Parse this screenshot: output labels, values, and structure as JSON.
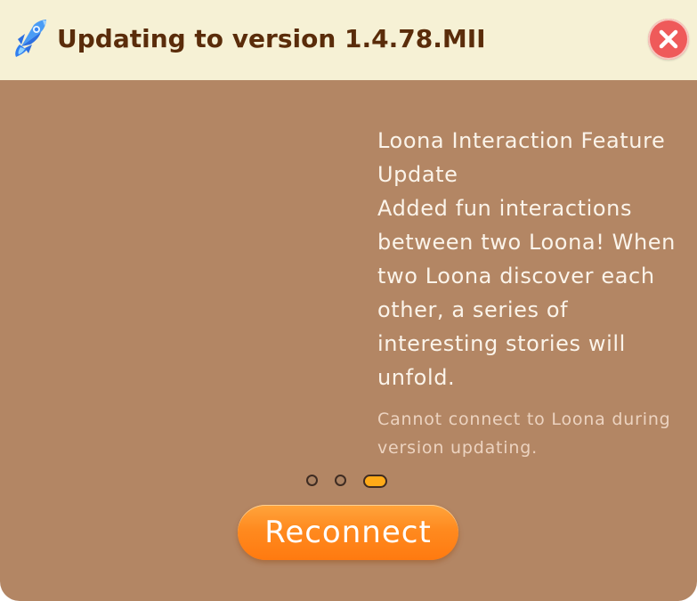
{
  "header": {
    "title": "Updating to version 1.4.78.MII",
    "icon": "rocket-icon",
    "close_icon": "close-icon"
  },
  "content": {
    "title": "Loona Interaction Feature Update",
    "body": "Added fun interactions between two Loona! When two Loona discover each other, a series of interesting stories will unfold.",
    "notice": "Cannot connect to Loona during version updating."
  },
  "pagination": {
    "current_page": 3,
    "total_pages": 3
  },
  "actions": {
    "reconnect_label": "Reconnect"
  },
  "colors": {
    "header_background": "#f6f1d5",
    "title": "#5a2c0a",
    "panel_background": "#b38664",
    "close_button": "#ef5a5a",
    "accent": "#ff8a1f",
    "active_dot": "#ffaa18"
  }
}
